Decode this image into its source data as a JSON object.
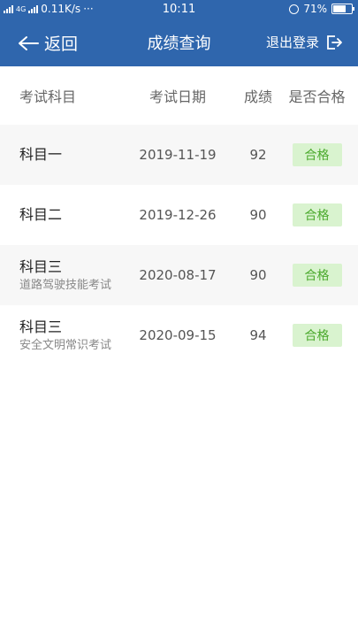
{
  "status_bar": {
    "network_left": "4G",
    "speed": "0.11K/s",
    "more": "···",
    "time": "10:11",
    "battery": "71%"
  },
  "nav": {
    "back_label": "返回",
    "title": "成绩查询",
    "logout_label": "退出登录"
  },
  "table": {
    "headers": {
      "subject": "考试科目",
      "date": "考试日期",
      "score": "成绩",
      "pass": "是否合格"
    },
    "rows": [
      {
        "subject": "科目一",
        "sub": "",
        "date": "2019-11-19",
        "score": "92",
        "result": "合格"
      },
      {
        "subject": "科目二",
        "sub": "",
        "date": "2019-12-26",
        "score": "90",
        "result": "合格"
      },
      {
        "subject": "科目三",
        "sub": "道路驾驶技能考试",
        "date": "2020-08-17",
        "score": "90",
        "result": "合格"
      },
      {
        "subject": "科目三",
        "sub": "安全文明常识考试",
        "date": "2020-09-15",
        "score": "94",
        "result": "合格"
      }
    ]
  },
  "colors": {
    "header_bg": "#2f66ad",
    "pass_badge_bg": "#d9f3cf",
    "pass_badge_text": "#4caa2e"
  }
}
